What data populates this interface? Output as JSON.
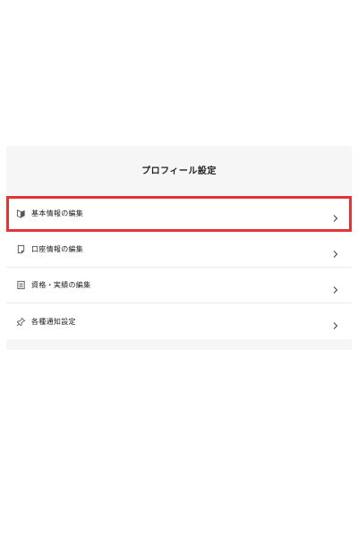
{
  "panel": {
    "title": "プロフィール設定"
  },
  "menu": {
    "items": [
      {
        "label": "基本情報の編集",
        "icon": "beginner-mark-icon",
        "highlighted": true
      },
      {
        "label": "口座情報の編集",
        "icon": "document-icon",
        "highlighted": false
      },
      {
        "label": "資格・実績の編集",
        "icon": "list-document-icon",
        "highlighted": false
      },
      {
        "label": "各種通知設定",
        "icon": "pin-icon",
        "highlighted": false
      }
    ]
  },
  "colors": {
    "highlight": "#e23434",
    "panel_background": "#f6f6f6",
    "divider": "#ececec"
  }
}
